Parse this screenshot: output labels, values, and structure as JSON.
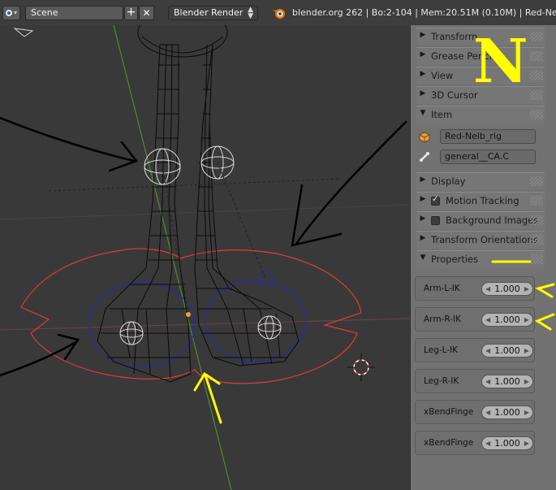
{
  "header": {
    "scene_name": "Scene",
    "add_glyph": "+",
    "remove_glyph": "✕",
    "render_engine": "Blender Render",
    "stats": "blender.org 262 | Bo:2-104 | Mem:20.51M (0.10M) | Red-Nelb_ri"
  },
  "panel": {
    "sections": [
      {
        "label": "Transform",
        "expanded": false
      },
      {
        "label": "Grease Pencil",
        "expanded": false
      },
      {
        "label": "View",
        "expanded": false
      },
      {
        "label": "3D Cursor",
        "expanded": false
      },
      {
        "label": "Item",
        "expanded": true
      },
      {
        "label": "Display",
        "expanded": false
      },
      {
        "label": "Motion Tracking",
        "expanded": false,
        "checked": true
      },
      {
        "label": "Background Images",
        "expanded": false,
        "checked": false
      },
      {
        "label": "Transform Orientations",
        "expanded": false
      },
      {
        "label": "Properties",
        "expanded": true
      }
    ],
    "item": {
      "object_name": "Red-Nelb_rig",
      "bone_name": "general__CA.C"
    },
    "properties": [
      {
        "label": "Arm-L-IK",
        "value": "1.000"
      },
      {
        "label": "Arm-R-IK",
        "value": "1.000"
      },
      {
        "label": "Leg-L-IK",
        "value": "1.000"
      },
      {
        "label": "Leg-R-IK",
        "value": "1.000"
      },
      {
        "label": "xBendFinge",
        "value": "1.000"
      },
      {
        "label": "xBendFinge",
        "value": "1.000"
      }
    ]
  },
  "annotations": {
    "big_letter": "N",
    "color": "#ffff00"
  },
  "colors": {
    "viewport_bg": "#393939",
    "panel_bg": "#727272",
    "wire_black": "#000000",
    "wire_white": "#d8d8d8",
    "ik_red": "#e03a3a",
    "ik_blue": "#2a2aa8",
    "axis_green": "#5aa02a"
  }
}
